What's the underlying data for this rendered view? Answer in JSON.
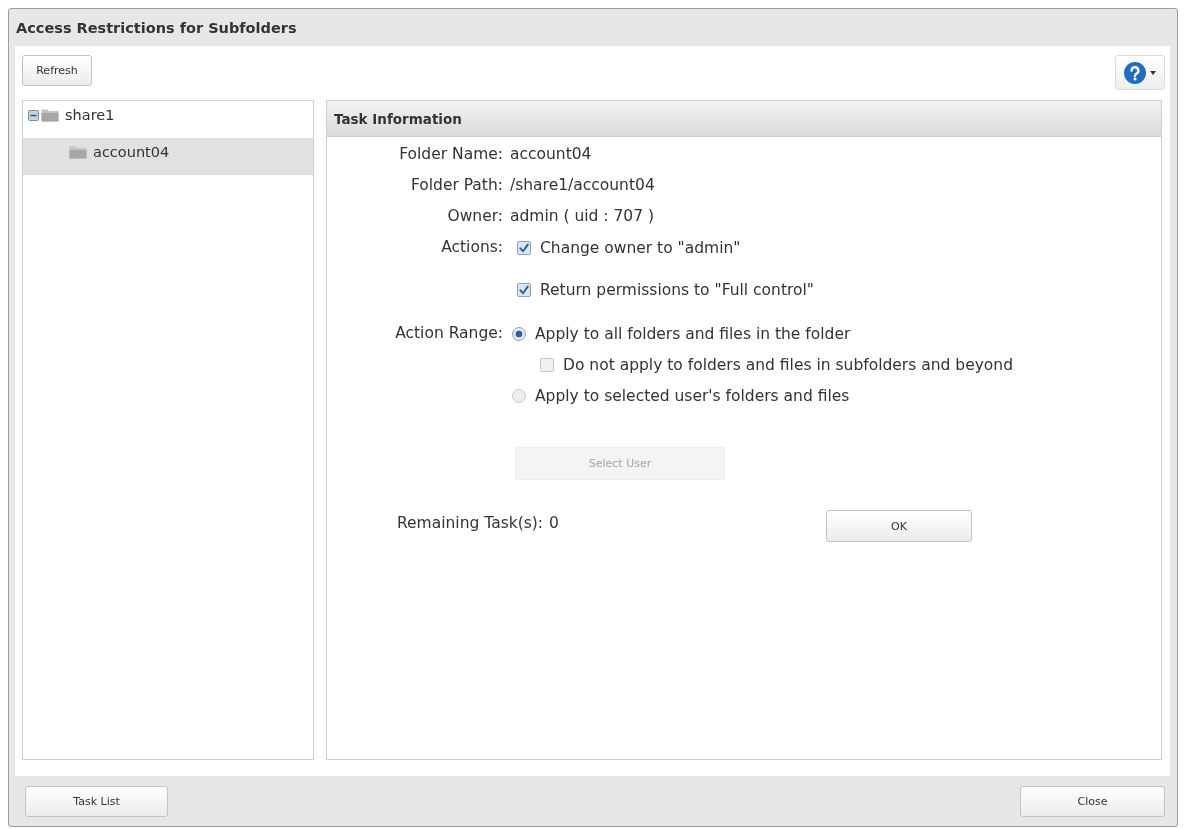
{
  "window": {
    "title": "Access Restrictions for Subfolders"
  },
  "toolbar": {
    "refresh_button": "Refresh"
  },
  "tree": {
    "items": [
      {
        "label": "share1",
        "expanded": true,
        "selected": false,
        "children": [
          {
            "label": "account04",
            "selected": true
          }
        ]
      }
    ]
  },
  "task_info": {
    "title": "Task Information",
    "fields": [
      {
        "label": "Folder Name:",
        "value": "account04"
      },
      {
        "label": "Folder Path:",
        "value": "/share1/account04"
      },
      {
        "label": "Owner:",
        "value": "admin ( uid : 707 )"
      }
    ],
    "actions": {
      "label": "Actions:",
      "options": [
        {
          "label": "Change owner to \"admin\"",
          "checked": true
        },
        {
          "label": "Return permissions to \"Full control\"",
          "checked": true
        }
      ]
    },
    "action_range": {
      "label": "Action Range:",
      "options": [
        {
          "label": "Apply to all folders and files in the folder",
          "selected": true,
          "sub_options": [
            {
              "label": "Do not apply to folders and files in subfolders and beyond",
              "checked": false
            }
          ]
        },
        {
          "label": "Apply to selected user's folders and files",
          "selected": false
        }
      ]
    },
    "select_user_button": {
      "label": "Select User",
      "disabled": true
    },
    "remaining": {
      "label": "Remaining Task(s):",
      "value": "0"
    },
    "ok_button": "OK"
  },
  "footer": {
    "task_list_button": "Task List",
    "close_button": "Close"
  }
}
